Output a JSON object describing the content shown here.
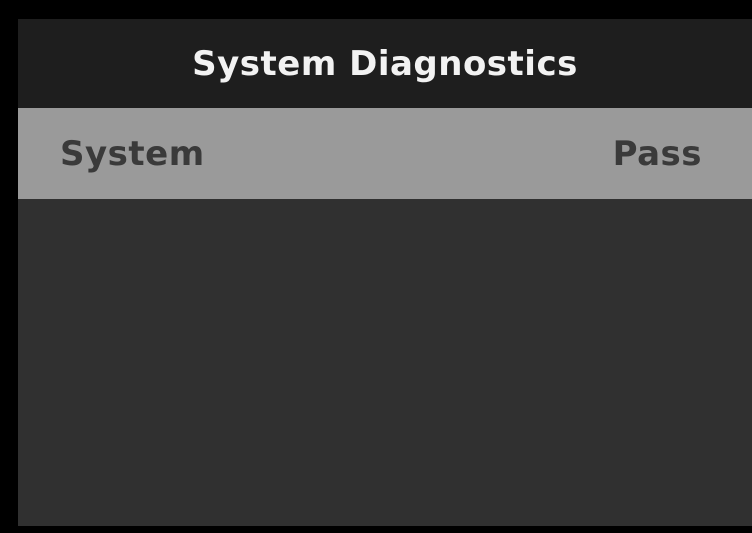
{
  "screen": {
    "title": "System Diagnostics",
    "rows": [
      {
        "label": "System",
        "value": "Pass",
        "selected": true
      }
    ]
  },
  "colors": {
    "bezel": "#000000",
    "title_bar": "#1e1e1e",
    "title_text": "#f2f2f2",
    "list_background": "#303030",
    "selected_row": "#9a9a9a",
    "selected_row_text": "#3a3a3a"
  }
}
